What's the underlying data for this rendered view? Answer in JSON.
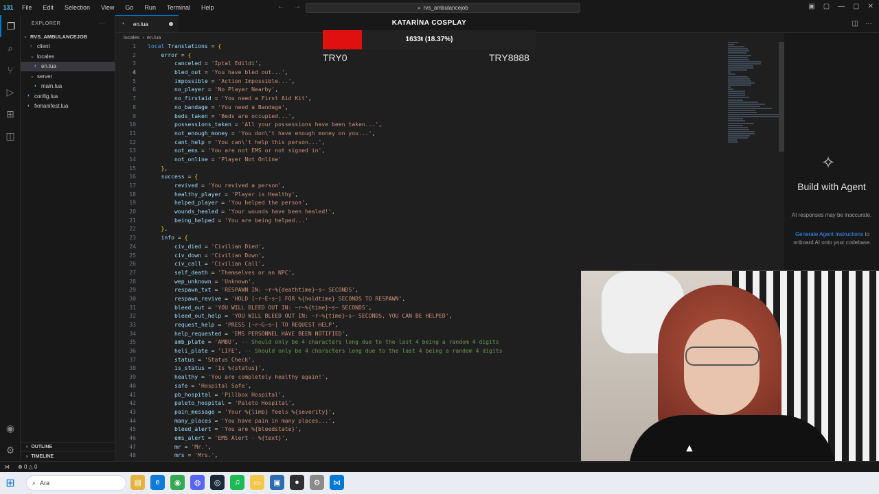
{
  "titlebar": {
    "menu": [
      "File",
      "Edit",
      "Selection",
      "View",
      "Go",
      "Run",
      "Terminal",
      "Help"
    ],
    "search_text": "rvs_ambulancejob",
    "badge": "131"
  },
  "sidebar": {
    "header": "EXPLORER",
    "root": "RVS_AMBULANCEJOB",
    "items": [
      {
        "label": "client",
        "type": "folder",
        "depth": 1
      },
      {
        "label": "locales",
        "type": "folder",
        "depth": 1
      },
      {
        "label": "en.lua",
        "type": "file",
        "depth": 2
      },
      {
        "label": "server",
        "type": "folder",
        "depth": 1
      },
      {
        "label": "main.lua",
        "type": "file",
        "depth": 2
      },
      {
        "label": "config.lua",
        "type": "file",
        "depth": 1
      },
      {
        "label": "fxmanifest.lua",
        "type": "file",
        "depth": 1
      }
    ],
    "outline": "OUTLINE",
    "timeline": "TIMELINE"
  },
  "editor": {
    "tab_label": "en.lua",
    "breadcrumb": [
      "locales",
      "en.lua"
    ],
    "current_line": 4
  },
  "code_lines": [
    [
      [
        "k",
        "local "
      ],
      [
        "v",
        "Translations"
      ],
      [
        "o",
        " = "
      ],
      [
        "p",
        "{"
      ]
    ],
    [
      [
        "o",
        "    "
      ],
      [
        "v",
        "error"
      ],
      [
        "o",
        " = "
      ],
      [
        "p",
        "{"
      ]
    ],
    [
      [
        "o",
        "        "
      ],
      [
        "v",
        "canceled"
      ],
      [
        "o",
        " = "
      ],
      [
        "s",
        "'İptal Edildi'"
      ],
      [
        "o",
        ","
      ]
    ],
    [
      [
        "o",
        "        "
      ],
      [
        "v",
        "bled_out"
      ],
      [
        "o",
        " = "
      ],
      [
        "s",
        "'You have bled out...'"
      ],
      [
        "o",
        ","
      ]
    ],
    [
      [
        "o",
        "        "
      ],
      [
        "v",
        "impossible"
      ],
      [
        "o",
        " = "
      ],
      [
        "s",
        "'Action Impossible...'"
      ],
      [
        "o",
        ","
      ]
    ],
    [
      [
        "o",
        "        "
      ],
      [
        "v",
        "no_player"
      ],
      [
        "o",
        " = "
      ],
      [
        "s",
        "'No Player Nearby'"
      ],
      [
        "o",
        ","
      ]
    ],
    [
      [
        "o",
        "        "
      ],
      [
        "v",
        "no_firstaid"
      ],
      [
        "o",
        " = "
      ],
      [
        "s",
        "'You need a First Aid Kit'"
      ],
      [
        "o",
        ","
      ]
    ],
    [
      [
        "o",
        "        "
      ],
      [
        "v",
        "no_bandage"
      ],
      [
        "o",
        " = "
      ],
      [
        "s",
        "'You need a Bandage'"
      ],
      [
        "o",
        ","
      ]
    ],
    [
      [
        "o",
        "        "
      ],
      [
        "v",
        "beds_taken"
      ],
      [
        "o",
        " = "
      ],
      [
        "s",
        "'Beds are occupied...'"
      ],
      [
        "o",
        ","
      ]
    ],
    [
      [
        "o",
        "        "
      ],
      [
        "v",
        "possessions_taken"
      ],
      [
        "o",
        " = "
      ],
      [
        "s",
        "'All your possessions have been taken...'"
      ],
      [
        "o",
        ","
      ]
    ],
    [
      [
        "o",
        "        "
      ],
      [
        "v",
        "not_enough_money"
      ],
      [
        "o",
        " = "
      ],
      [
        "s",
        "'You don\\'t have enough money on you...'"
      ],
      [
        "o",
        ","
      ]
    ],
    [
      [
        "o",
        "        "
      ],
      [
        "v",
        "cant_help"
      ],
      [
        "o",
        " = "
      ],
      [
        "s",
        "'You can\\'t help this person...'"
      ],
      [
        "o",
        ","
      ]
    ],
    [
      [
        "o",
        "        "
      ],
      [
        "v",
        "not_ems"
      ],
      [
        "o",
        " = "
      ],
      [
        "s",
        "'You are not EMS or not signed in'"
      ],
      [
        "o",
        ","
      ]
    ],
    [
      [
        "o",
        "        "
      ],
      [
        "v",
        "not_online"
      ],
      [
        "o",
        " = "
      ],
      [
        "s",
        "'Player Not Online'"
      ]
    ],
    [
      [
        "o",
        "    "
      ],
      [
        "p",
        "}"
      ],
      [
        "o",
        ","
      ]
    ],
    [
      [
        "o",
        "    "
      ],
      [
        "v",
        "success"
      ],
      [
        "o",
        " = "
      ],
      [
        "p",
        "{"
      ]
    ],
    [
      [
        "o",
        "        "
      ],
      [
        "v",
        "revived"
      ],
      [
        "o",
        " = "
      ],
      [
        "s",
        "'You revived a person'"
      ],
      [
        "o",
        ","
      ]
    ],
    [
      [
        "o",
        "        "
      ],
      [
        "v",
        "healthy_player"
      ],
      [
        "o",
        " = "
      ],
      [
        "s",
        "'Player is Healthy'"
      ],
      [
        "o",
        ","
      ]
    ],
    [
      [
        "o",
        "        "
      ],
      [
        "v",
        "helped_player"
      ],
      [
        "o",
        " = "
      ],
      [
        "s",
        "'You helped the person'"
      ],
      [
        "o",
        ","
      ]
    ],
    [
      [
        "o",
        "        "
      ],
      [
        "v",
        "wounds_healed"
      ],
      [
        "o",
        " = "
      ],
      [
        "s",
        "'Your wounds have been healed!'"
      ],
      [
        "o",
        ","
      ]
    ],
    [
      [
        "o",
        "        "
      ],
      [
        "v",
        "being_helped"
      ],
      [
        "o",
        " = "
      ],
      [
        "s",
        "'You are being helped...'"
      ]
    ],
    [
      [
        "o",
        "    "
      ],
      [
        "p",
        "}"
      ],
      [
        "o",
        ","
      ]
    ],
    [
      [
        "o",
        "    "
      ],
      [
        "v",
        "info"
      ],
      [
        "o",
        " = "
      ],
      [
        "p",
        "{"
      ]
    ],
    [
      [
        "o",
        "        "
      ],
      [
        "v",
        "civ_died"
      ],
      [
        "o",
        " = "
      ],
      [
        "s",
        "'Civilian Died'"
      ],
      [
        "o",
        ","
      ]
    ],
    [
      [
        "o",
        "        "
      ],
      [
        "v",
        "civ_down"
      ],
      [
        "o",
        " = "
      ],
      [
        "s",
        "'Civilian Down'"
      ],
      [
        "o",
        ","
      ]
    ],
    [
      [
        "o",
        "        "
      ],
      [
        "v",
        "civ_call"
      ],
      [
        "o",
        " = "
      ],
      [
        "s",
        "'Civilian Call'"
      ],
      [
        "o",
        ","
      ]
    ],
    [
      [
        "o",
        "        "
      ],
      [
        "v",
        "self_death"
      ],
      [
        "o",
        " = "
      ],
      [
        "s",
        "'Themselves or an NPC'"
      ],
      [
        "o",
        ","
      ]
    ],
    [
      [
        "o",
        "        "
      ],
      [
        "v",
        "wep_unknown"
      ],
      [
        "o",
        " = "
      ],
      [
        "s",
        "'Unknown'"
      ],
      [
        "o",
        ","
      ]
    ],
    [
      [
        "o",
        "        "
      ],
      [
        "v",
        "respawn_txt"
      ],
      [
        "o",
        " = "
      ],
      [
        "s",
        "'RESPAWN IN: ~r~%{deathtime}~s~ SECONDS'"
      ],
      [
        "o",
        ","
      ]
    ],
    [
      [
        "o",
        "        "
      ],
      [
        "v",
        "respawn_revive"
      ],
      [
        "o",
        " = "
      ],
      [
        "s",
        "'HOLD [~r~E~s~] FOR %{holdtime} SECONDS TO RESPAWN'"
      ],
      [
        "o",
        ","
      ]
    ],
    [
      [
        "o",
        "        "
      ],
      [
        "v",
        "bleed_out"
      ],
      [
        "o",
        " = "
      ],
      [
        "s",
        "'YOU WILL BLEED OUT IN: ~r~%{time}~s~ SECONDS'"
      ],
      [
        "o",
        ","
      ]
    ],
    [
      [
        "o",
        "        "
      ],
      [
        "v",
        "bleed_out_help"
      ],
      [
        "o",
        " = "
      ],
      [
        "s",
        "'YOU WILL BLEED OUT IN: ~r~%{time}~s~ SECONDS, YOU CAN BE HELPED'"
      ],
      [
        "o",
        ","
      ]
    ],
    [
      [
        "o",
        "        "
      ],
      [
        "v",
        "request_help"
      ],
      [
        "o",
        " = "
      ],
      [
        "s",
        "'PRESS [~r~G~s~] TO REQUEST HELP'"
      ],
      [
        "o",
        ","
      ]
    ],
    [
      [
        "o",
        "        "
      ],
      [
        "v",
        "help_requested"
      ],
      [
        "o",
        " = "
      ],
      [
        "s",
        "'EMS PERSONNEL HAVE BEEN NOTIFIED'"
      ],
      [
        "o",
        ","
      ]
    ],
    [
      [
        "o",
        "        "
      ],
      [
        "v",
        "amb_plate"
      ],
      [
        "o",
        " = "
      ],
      [
        "s",
        "'AMBU'"
      ],
      [
        "o",
        ", "
      ],
      [
        "c",
        "-- Should only be 4 characters long due to the last 4 being a random 4 digits"
      ]
    ],
    [
      [
        "o",
        "        "
      ],
      [
        "v",
        "heli_plate"
      ],
      [
        "o",
        " = "
      ],
      [
        "s",
        "'LIFE'"
      ],
      [
        "o",
        ", "
      ],
      [
        "c",
        "-- Should only be 4 characters long due to the last 4 being a random 4 digits"
      ]
    ],
    [
      [
        "o",
        "        "
      ],
      [
        "v",
        "status"
      ],
      [
        "o",
        " = "
      ],
      [
        "s",
        "'Status Check'"
      ],
      [
        "o",
        ","
      ]
    ],
    [
      [
        "o",
        "        "
      ],
      [
        "v",
        "is_status"
      ],
      [
        "o",
        " = "
      ],
      [
        "s",
        "'Is %{status}'"
      ],
      [
        "o",
        ","
      ]
    ],
    [
      [
        "o",
        "        "
      ],
      [
        "v",
        "healthy"
      ],
      [
        "o",
        " = "
      ],
      [
        "s",
        "'You are completely healthy again!'"
      ],
      [
        "o",
        ","
      ]
    ],
    [
      [
        "o",
        "        "
      ],
      [
        "v",
        "safe"
      ],
      [
        "o",
        " = "
      ],
      [
        "s",
        "'Hospital Safe'"
      ],
      [
        "o",
        ","
      ]
    ],
    [
      [
        "o",
        "        "
      ],
      [
        "v",
        "pb_hospital"
      ],
      [
        "o",
        " = "
      ],
      [
        "s",
        "'Pillbox Hospital'"
      ],
      [
        "o",
        ","
      ]
    ],
    [
      [
        "o",
        "        "
      ],
      [
        "v",
        "paleto_hospital"
      ],
      [
        "o",
        " = "
      ],
      [
        "s",
        "'Paleto Hospital'"
      ],
      [
        "o",
        ","
      ]
    ],
    [
      [
        "o",
        "        "
      ],
      [
        "v",
        "pain_message"
      ],
      [
        "o",
        " = "
      ],
      [
        "s",
        "'Your %{limb} feels %{severity}'"
      ],
      [
        "o",
        ","
      ]
    ],
    [
      [
        "o",
        "        "
      ],
      [
        "v",
        "many_places"
      ],
      [
        "o",
        " = "
      ],
      [
        "s",
        "'You have pain in many places...'"
      ],
      [
        "o",
        ","
      ]
    ],
    [
      [
        "o",
        "        "
      ],
      [
        "v",
        "bleed_alert"
      ],
      [
        "o",
        " = "
      ],
      [
        "s",
        "'You are %{bleedstate}'"
      ],
      [
        "o",
        ","
      ]
    ],
    [
      [
        "o",
        "        "
      ],
      [
        "v",
        "ems_alert"
      ],
      [
        "o",
        " = "
      ],
      [
        "s",
        "'EMS Alert - %{text}'"
      ],
      [
        "o",
        ","
      ]
    ],
    [
      [
        "o",
        "        "
      ],
      [
        "v",
        "mr"
      ],
      [
        "o",
        " = "
      ],
      [
        "s",
        "'Mr.'"
      ],
      [
        "o",
        ","
      ]
    ],
    [
      [
        "o",
        "        "
      ],
      [
        "v",
        "mrs"
      ],
      [
        "o",
        " = "
      ],
      [
        "s",
        "'Mrs.'"
      ],
      [
        "o",
        ","
      ]
    ]
  ],
  "agent_panel": {
    "title": "Build with Agent",
    "subtitle": "AI responses may be inaccurate.",
    "link": "Generate Agent Instructions",
    "link_suffix": " to onboard AI onto your codebase."
  },
  "overlay": {
    "title": "KATARİNA COSPLAY",
    "progress_text": "1633ŧ (18.37%)",
    "progress_fraction": 0.1837,
    "team_left": "TRY0",
    "team_right": "TRY8888",
    "bar_color": "#e01010"
  },
  "statusbar": {
    "errors": "0",
    "warnings": "0"
  },
  "taskbar": {
    "search_placeholder": "Ara",
    "apps": [
      "file-explorer-icon",
      "edge-icon",
      "chrome-icon",
      "discord-icon",
      "steam-icon",
      "spotify-icon",
      "folder-icon",
      "app-icon",
      "obs-icon",
      "settings-icon",
      "vscode-icon"
    ]
  }
}
